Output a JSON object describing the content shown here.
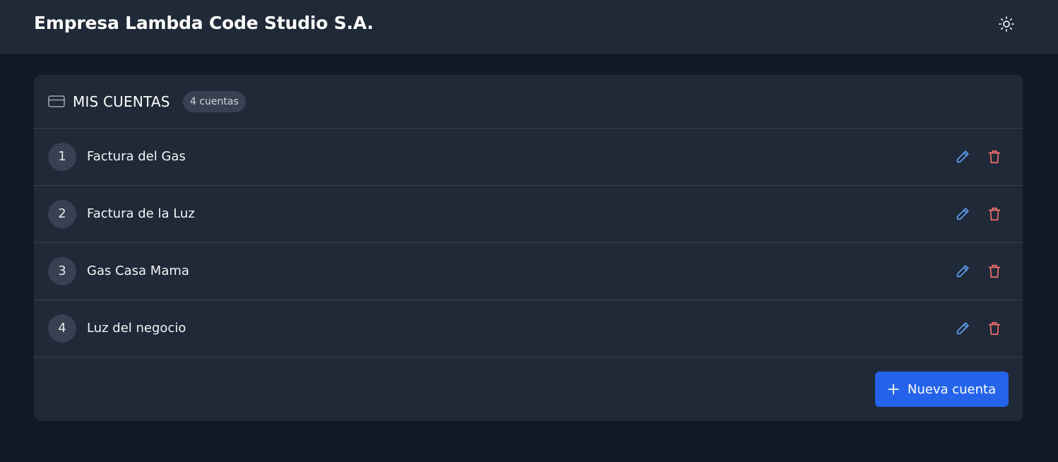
{
  "header": {
    "title": "Empresa Lambda Code Studio S.A.",
    "theme_icon": "sun-icon"
  },
  "card": {
    "icon": "credit-card-icon",
    "title": "MIS CUENTAS",
    "count_badge": "4 cuentas"
  },
  "accounts": [
    {
      "number": "1",
      "name": "Factura del Gas"
    },
    {
      "number": "2",
      "name": "Factura de la Luz"
    },
    {
      "number": "3",
      "name": "Gas Casa Mama"
    },
    {
      "number": "4",
      "name": "Luz del negocio"
    }
  ],
  "actions": {
    "edit_icon": "pencil-icon",
    "delete_icon": "trash-icon",
    "new_button_label": "Nueva cuenta"
  },
  "colors": {
    "background": "#111827",
    "surface": "#1f2937",
    "accent": "#2563eb",
    "edit": "#60a5fa",
    "delete": "#f87171"
  }
}
